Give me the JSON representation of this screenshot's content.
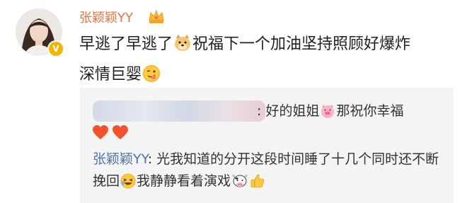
{
  "post": {
    "username": "张颖颖YY",
    "text_line1_a": "早逃了早逃了",
    "text_line1_b": "祝福下一个加油坚持照顾好爆炸",
    "text_line2": "深情巨婴"
  },
  "quote": {
    "reply1_text": ": 好的姐姐",
    "reply1_text_b": "那祝你幸福",
    "reply2_name": "张颖颖YY",
    "reply2_text": ": 光我知道的分开这段时间睡了十几个同时还不断挽回",
    "reply2_text_b": "我静静看着演戏"
  },
  "colors": {
    "username": "#eb7340",
    "reply_name": "#4f77a8",
    "quote_bg": "#f4f4f5",
    "verified_badge": "#f6b400"
  },
  "icons": [
    "crown-icon",
    "verified-badge-icon",
    "doge-emoji-icon",
    "tongue-emoji-icon",
    "pig-emoji-icon",
    "heart-icon",
    "laughing-emoji-icon",
    "cow-emoji-icon",
    "thumbs-up-icon"
  ]
}
